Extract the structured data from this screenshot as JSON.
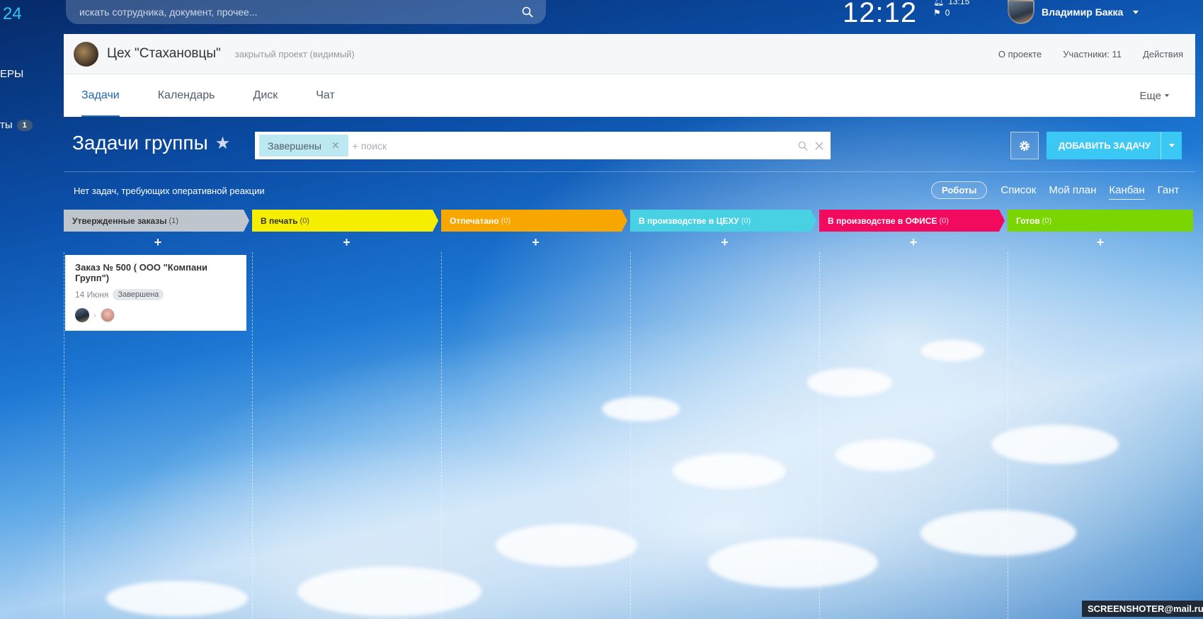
{
  "left_nav": {
    "logo_fragment": "24",
    "item_1_fragment": "ЕРЫ",
    "item_2_fragment": "ты",
    "item_2_count": "1"
  },
  "topbar": {
    "search_placeholder": "искать сотрудника, документ, прочее...",
    "clock": "12:12",
    "alarm_time": "13:15",
    "flag_count": "0",
    "user_name": "Владимир Бакка"
  },
  "project": {
    "name": "Цех \"Стахановцы\"",
    "type": "закрытый проект (видимый)",
    "links": [
      "О проекте",
      "Участники: 11",
      "Действия"
    ],
    "tabs": [
      "Задачи",
      "Календарь",
      "Диск",
      "Чат"
    ],
    "active_tab": "Задачи",
    "more": "Еще"
  },
  "tasks": {
    "title": "Задачи группы",
    "filter_chip": "Завершены",
    "filter_plus": "+",
    "search_placeholder": "поиск",
    "add_button": "ДОБАВИТЬ ЗАДАЧУ",
    "counter_text": "Нет задач, требующих оперативной реакции",
    "robots": "Роботы",
    "views": [
      "Список",
      "Мой план",
      "Канбан",
      "Гант"
    ],
    "active_view": "Канбан"
  },
  "kanban": {
    "add_symbol": "+",
    "columns": [
      {
        "title": "Утвержденные заказы",
        "count": "(1)",
        "color": "#bfc5cd",
        "text_color": "#333333"
      },
      {
        "title": "В печать",
        "count": "(0)",
        "color": "#f5ee00",
        "text_color": "#333333"
      },
      {
        "title": "Отпечатано",
        "count": "(0)",
        "color": "#f7a700",
        "text_color": "#ffffff"
      },
      {
        "title": "В производстве в ЦЕХУ",
        "count": "(0)",
        "color": "#47d1e2",
        "text_color": "#ffffff"
      },
      {
        "title": "В производстве в ОФИСЕ",
        "count": "(0)",
        "color": "#f20a5e",
        "text_color": "#ffffff"
      },
      {
        "title": "Готов",
        "count": "(0)",
        "color": "#7bd500",
        "text_color": "#ffffff"
      }
    ],
    "card": {
      "title": "Заказ № 500 ( ООО \"Компани Групп\")",
      "date": "14 Июня",
      "status": "Завершена"
    }
  },
  "watermark": "SCREENSHOTER@mail.ru"
}
